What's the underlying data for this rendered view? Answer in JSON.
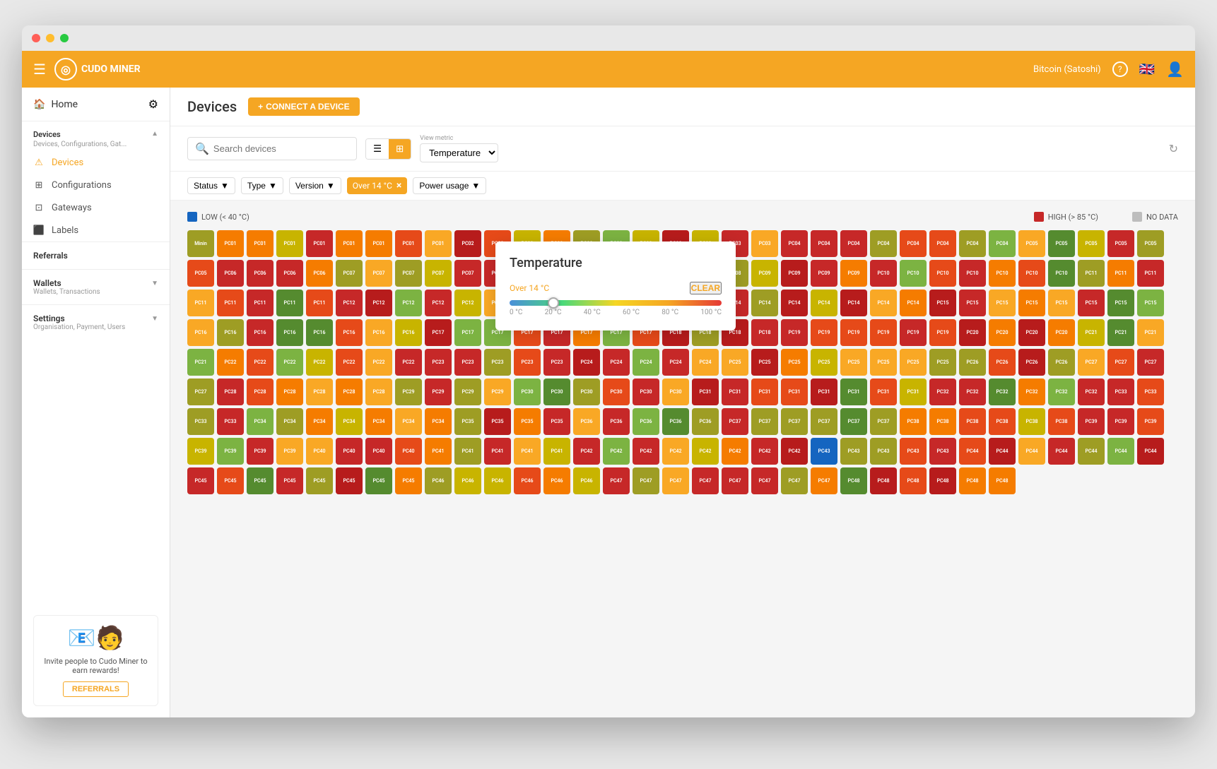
{
  "window": {
    "titlebar_buttons": [
      "red",
      "yellow",
      "green"
    ]
  },
  "topnav": {
    "logo_text": "CUDO\nMINER",
    "currency": "Bitcoin (Satoshi)",
    "help_icon": "?",
    "flag_icon": "🇬🇧"
  },
  "sidebar": {
    "home_label": "Home",
    "devices_section": {
      "title": "Devices",
      "subtitle": "Devices, Configurations, Gat...",
      "items": [
        {
          "label": "Devices",
          "active": true
        },
        {
          "label": "Configurations"
        },
        {
          "label": "Gateways"
        },
        {
          "label": "Labels"
        }
      ]
    },
    "referrals": {
      "label": "Referrals"
    },
    "wallets": {
      "label": "Wallets",
      "subtitle": "Wallets, Transactions"
    },
    "settings": {
      "label": "Settings",
      "subtitle": "Organisation, Payment, Users"
    },
    "promo": {
      "text": "Invite people to Cudo Miner to earn rewards!",
      "button": "REFERRALS"
    }
  },
  "content": {
    "page_title": "Devices",
    "connect_button": "CONNECT A DEVICE",
    "search_placeholder": "Search devices",
    "view_metric_label": "View metric",
    "view_metric_value": "Temperature",
    "filters": {
      "status_label": "Status",
      "type_label": "Type",
      "version_label": "Version",
      "active_filter": "Over 14 °C",
      "power_usage_label": "Power usage"
    },
    "legend": {
      "low_label": "LOW (< 40 °C)",
      "high_label": "HIGH (> 85 °C)",
      "no_data_label": "NO DATA",
      "low_color": "#1565c0",
      "high_color": "#c62828",
      "no_data_color": "#bdbdbd"
    }
  },
  "temperature_popup": {
    "title": "Temperature",
    "range_label": "Over 14 °C",
    "clear_label": "CLEAR",
    "labels": [
      "0 °C",
      "20 °C",
      "40 °C",
      "60 °C",
      "80 °C",
      "100 °C"
    ]
  },
  "devices": {
    "colors": {
      "red": "#c62828",
      "darkred": "#b71c1c",
      "orange": "#e64a19",
      "orange2": "#f57c00",
      "yellow": "#f9a825",
      "lime": "#9e9d24",
      "green": "#558b2f",
      "green2": "#7cb342",
      "blue": "#1565c0",
      "gray": "#9e9e9e"
    }
  }
}
